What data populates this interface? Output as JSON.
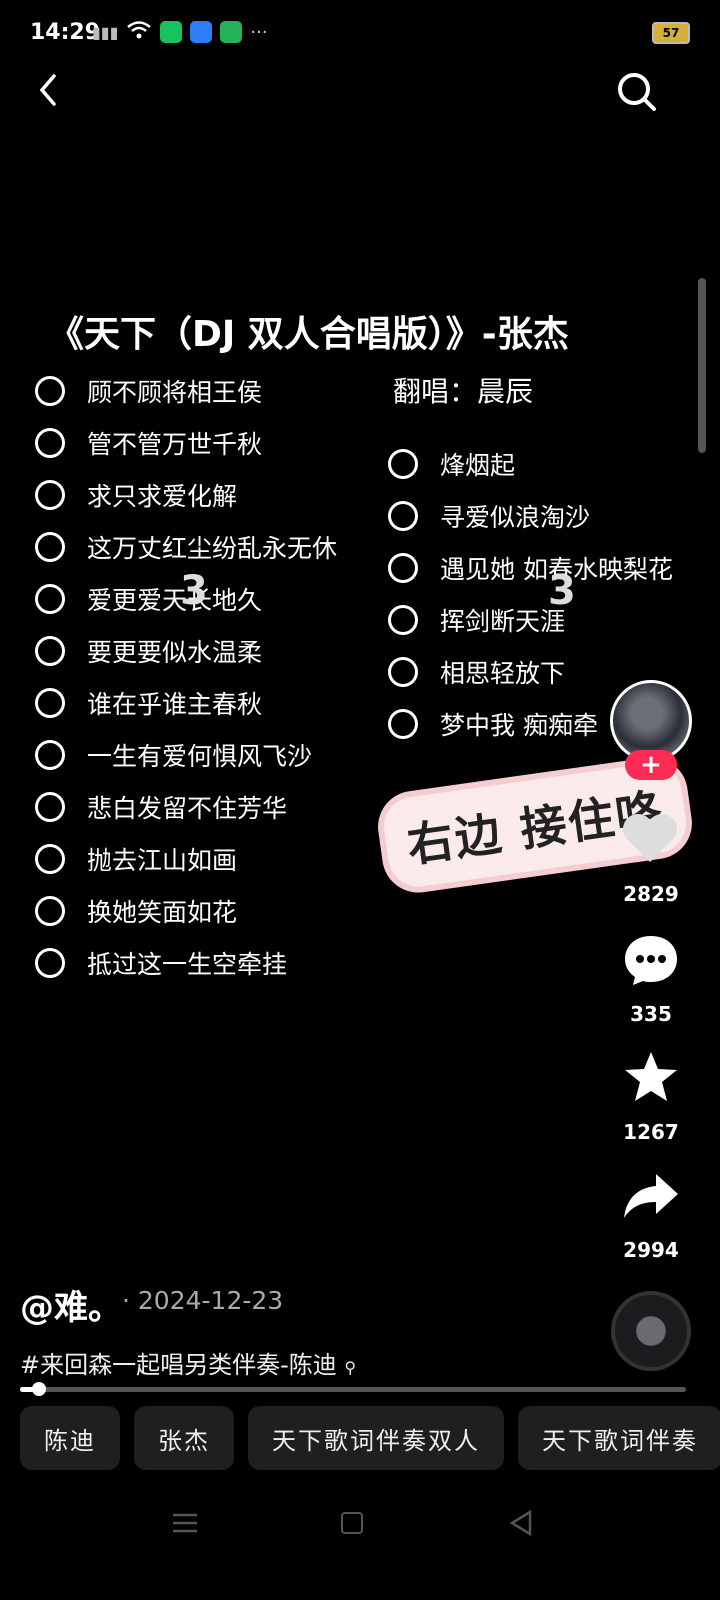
{
  "status": {
    "time": "14:29",
    "battery": "57",
    "more": "···"
  },
  "video": {
    "title": "《天下（DJ 双人合唱版）》-张杰",
    "cover_label": "翻唱：",
    "cover_name": "晨辰",
    "left_lyrics": [
      "顾不顾将相王侯",
      "管不管万世千秋",
      "求只求爱化解",
      "这万丈红尘纷乱永无休",
      "爱更爱天长地久",
      "要更要似水温柔",
      "谁在乎谁主春秋",
      "一生有爱何惧风飞沙",
      "悲白发留不住芳华",
      "抛去江山如画",
      "换她笑面如花",
      "抵过这一生空牵挂"
    ],
    "right_lyrics": [
      "烽烟起",
      "寻爱似浪淘沙",
      "遇见她 如春水映梨花",
      "挥剑断天涯",
      "相思轻放下",
      "梦中我 痴痴牵"
    ],
    "badge_left": "3",
    "badge_right": "3",
    "sticker": "右边 接住咯"
  },
  "rail": {
    "follow": "+",
    "likes": "2829",
    "comments": "335",
    "favorites": "1267",
    "shares": "2994"
  },
  "info": {
    "author": "@难。",
    "date": "· 2024-12-23",
    "description": "#来回森一起唱另类伴奏-陈迪",
    "progress": 0.03
  },
  "tags": [
    "陈迪",
    "张杰",
    "天下歌词伴奏双人",
    "天下歌词伴奏"
  ]
}
